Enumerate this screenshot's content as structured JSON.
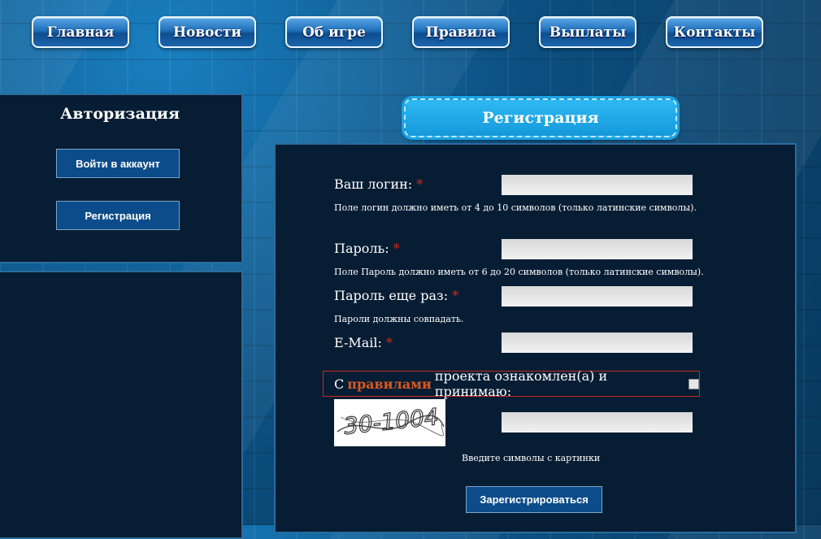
{
  "nav": [
    {
      "label": "Главная"
    },
    {
      "label": "Новости"
    },
    {
      "label": "Об игре"
    },
    {
      "label": "Правила"
    },
    {
      "label": "Выплаты"
    },
    {
      "label": "Контакты"
    }
  ],
  "sidebar": {
    "title": "Авторизация",
    "login_button": "Войти в аккаунт",
    "register_button": "Регистрация"
  },
  "form": {
    "title": "Регистрация",
    "login_label": "Ваш логин:",
    "login_hint": "Поле логин должно иметь от 4 до 10 символов (только латинские символы).",
    "password_label": "Пароль:",
    "password_hint": "Поле Пароль должно иметь от 6 до 20 символов (только латинские символы).",
    "password2_label": "Пароль еще раз:",
    "password2_hint": "Пароли должны совпадать.",
    "email_label": "E-Mail:",
    "required_mark": "*",
    "rules_prefix": "С",
    "rules_link": "правилами",
    "rules_suffix": "проекта ознакомлен(а) и принимаю:",
    "captcha_text": "30-1004",
    "captcha_hint": "Введите символы с картинки",
    "submit_button": "Зарегистрироваться"
  },
  "colors": {
    "panel": "#071d33",
    "button": "#0d4c8a",
    "accent": "#1599db",
    "required": "#e0241b",
    "link": "#d9591f"
  }
}
